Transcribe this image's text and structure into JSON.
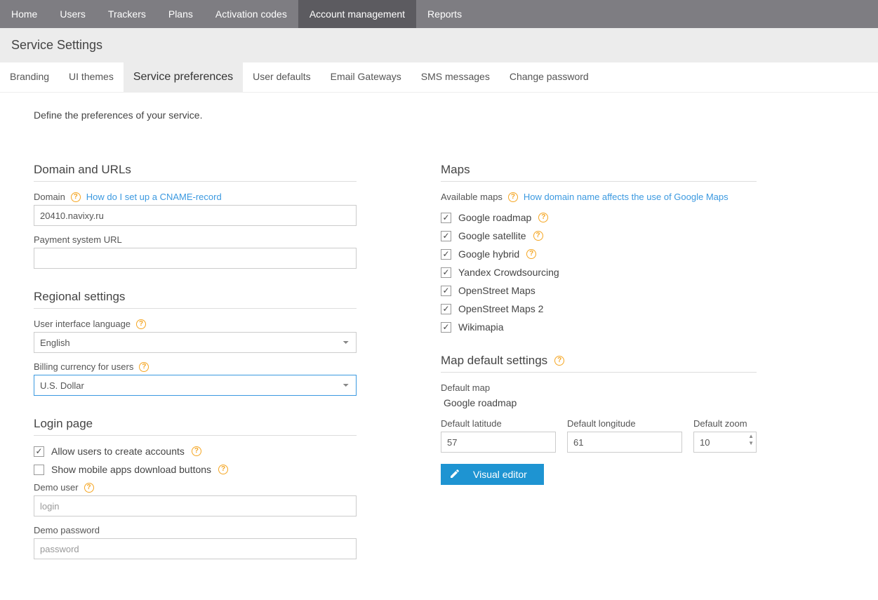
{
  "topnav": {
    "items": [
      "Home",
      "Users",
      "Trackers",
      "Plans",
      "Activation codes",
      "Account management",
      "Reports"
    ],
    "active_index": 5
  },
  "page_title": "Service Settings",
  "tabs": {
    "items": [
      "Branding",
      "UI themes",
      "Service preferences",
      "User defaults",
      "Email Gateways",
      "SMS messages",
      "Change password"
    ],
    "active_index": 2
  },
  "intro": "Define the preferences of your service.",
  "domain_section": {
    "title": "Domain and URLs",
    "domain_label": "Domain",
    "domain_help_link": "How do I set up a CNAME-record",
    "domain_value": "20410.navixy.ru",
    "payment_label": "Payment system URL",
    "payment_value": ""
  },
  "regional_section": {
    "title": "Regional settings",
    "lang_label": "User interface language",
    "lang_value": "English",
    "currency_label": "Billing currency for users",
    "currency_value": "U.S. Dollar"
  },
  "login_section": {
    "title": "Login page",
    "allow_create_label": "Allow users to create accounts",
    "allow_create_checked": true,
    "show_mobile_label": "Show mobile apps download buttons",
    "show_mobile_checked": false,
    "demo_user_label": "Demo user",
    "demo_user_placeholder": "login",
    "demo_user_value": "",
    "demo_password_label": "Demo password",
    "demo_password_placeholder": "password",
    "demo_password_value": ""
  },
  "maps_section": {
    "title": "Maps",
    "available_label": "Available maps",
    "help_link": "How domain name affects the use of Google Maps",
    "items": [
      {
        "label": "Google roadmap",
        "checked": true,
        "help": true
      },
      {
        "label": "Google satellite",
        "checked": true,
        "help": true
      },
      {
        "label": "Google hybrid",
        "checked": true,
        "help": true
      },
      {
        "label": "Yandex Crowdsourcing",
        "checked": true,
        "help": false
      },
      {
        "label": "OpenStreet Maps",
        "checked": true,
        "help": false
      },
      {
        "label": "OpenStreet Maps 2",
        "checked": true,
        "help": false
      },
      {
        "label": "Wikimapia",
        "checked": true,
        "help": false
      }
    ]
  },
  "map_defaults_section": {
    "title": "Map default settings",
    "default_map_label": "Default map",
    "default_map_value": "Google roadmap",
    "lat_label": "Default latitude",
    "lat_value": "57",
    "lon_label": "Default longitude",
    "lon_value": "61",
    "zoom_label": "Default zoom",
    "zoom_value": "10",
    "visual_editor_label": "Visual editor"
  }
}
